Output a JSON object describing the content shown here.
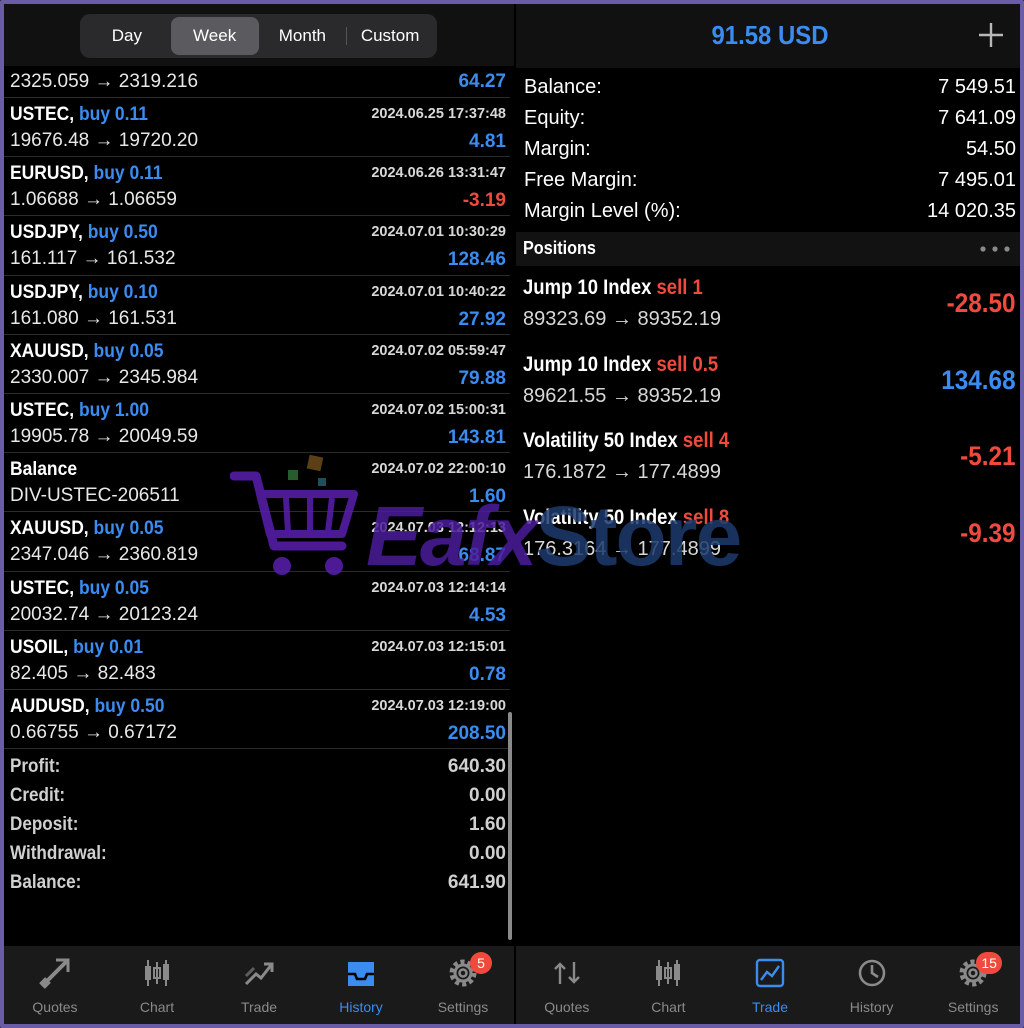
{
  "left": {
    "segments": [
      {
        "label": "Day",
        "active": false
      },
      {
        "label": "Week",
        "active": true
      },
      {
        "label": "Month",
        "active": false
      },
      {
        "label": "Custom",
        "active": false
      }
    ],
    "first_row": {
      "price": "2325.059 → 2319.216",
      "profit": "64.27"
    },
    "deals": [
      {
        "symbol": "USTEC,",
        "side": "buy 0.11",
        "date": "2024.06.25 17:37:48",
        "price": "19676.48 → 19720.20",
        "profit": "4.81",
        "negative": false
      },
      {
        "symbol": "EURUSD,",
        "side": "buy 0.11",
        "date": "2024.06.26 13:31:47",
        "price": "1.06688 → 1.06659",
        "profit": "-3.19",
        "negative": true
      },
      {
        "symbol": "USDJPY,",
        "side": "buy 0.50",
        "date": "2024.07.01 10:30:29",
        "price": "161.117 → 161.532",
        "profit": "128.46",
        "negative": false
      },
      {
        "symbol": "USDJPY,",
        "side": "buy 0.10",
        "date": "2024.07.01 10:40:22",
        "price": "161.080 → 161.531",
        "profit": "27.92",
        "negative": false
      },
      {
        "symbol": "XAUUSD,",
        "side": "buy 0.05",
        "date": "2024.07.02 05:59:47",
        "price": "2330.007 → 2345.984",
        "profit": "79.88",
        "negative": false
      },
      {
        "symbol": "USTEC,",
        "side": "buy 1.00",
        "date": "2024.07.02 15:00:31",
        "price": "19905.78 → 20049.59",
        "profit": "143.81",
        "negative": false
      },
      {
        "symbol": "Balance",
        "side": "",
        "date": "2024.07.02 22:00:10",
        "price": "DIV-USTEC-206511",
        "profit": "1.60",
        "negative": false
      },
      {
        "symbol": "XAUUSD,",
        "side": "buy 0.05",
        "date": "2024.07.03 12:12:13",
        "price": "2347.046 → 2360.819",
        "profit": "68.87",
        "negative": false
      },
      {
        "symbol": "USTEC,",
        "side": "buy 0.05",
        "date": "2024.07.03 12:14:14",
        "price": "20032.74 → 20123.24",
        "profit": "4.53",
        "negative": false
      },
      {
        "symbol": "USOIL,",
        "side": "buy 0.01",
        "date": "2024.07.03 12:15:01",
        "price": "82.405 → 82.483",
        "profit": "0.78",
        "negative": false
      },
      {
        "symbol": "AUDUSD,",
        "side": "buy 0.50",
        "date": "2024.07.03 12:19:00",
        "price": "0.66755 → 0.67172",
        "profit": "208.50",
        "negative": false
      }
    ],
    "summary": [
      {
        "label": "Profit:",
        "value": "640.30"
      },
      {
        "label": "Credit:",
        "value": "0.00"
      },
      {
        "label": "Deposit:",
        "value": "1.60"
      },
      {
        "label": "Withdrawal:",
        "value": "0.00"
      },
      {
        "label": "Balance:",
        "value": "641.90"
      }
    ],
    "tabs": [
      {
        "label": "Quotes",
        "icon": "quotes-icon",
        "active": false
      },
      {
        "label": "Chart",
        "icon": "chart-icon",
        "active": false
      },
      {
        "label": "Trade",
        "icon": "trade-icon",
        "active": false
      },
      {
        "label": "History",
        "icon": "history-icon",
        "active": true
      },
      {
        "label": "Settings",
        "icon": "gear-icon",
        "active": false,
        "badge": "5"
      }
    ]
  },
  "right": {
    "title": "91.58 USD",
    "account": [
      {
        "label": "Balance:",
        "value": "7 549.51"
      },
      {
        "label": "Equity:",
        "value": "7 641.09"
      },
      {
        "label": "Margin:",
        "value": "54.50"
      },
      {
        "label": "Free Margin:",
        "value": "7 495.01"
      },
      {
        "label": "Margin Level (%):",
        "value": "14 020.35"
      }
    ],
    "positions_label": "Positions",
    "positions": [
      {
        "symbol": "Jump 10 Index",
        "side": "sell 1",
        "price": "89323.69 → 89352.19",
        "profit": "-28.50",
        "negative": true
      },
      {
        "symbol": "Jump 10 Index",
        "side": "sell 0.5",
        "price": "89621.55 → 89352.19",
        "profit": "134.68",
        "negative": false
      },
      {
        "symbol": "Volatility 50 Index",
        "side": "sell 4",
        "price": "176.1872 → 177.4899",
        "profit": "-5.21",
        "negative": true
      },
      {
        "symbol": "Volatility 50 Index",
        "side": "sell 8",
        "price": "176.3164 → 177.4899",
        "profit": "-9.39",
        "negative": true
      }
    ],
    "tabs": [
      {
        "label": "Quotes",
        "icon": "quotes-icon",
        "active": false
      },
      {
        "label": "Chart",
        "icon": "chart-icon",
        "active": false
      },
      {
        "label": "Trade",
        "icon": "trade-icon",
        "active": true
      },
      {
        "label": "History",
        "icon": "history-icon",
        "active": false
      },
      {
        "label": "Settings",
        "icon": "gear-icon",
        "active": false,
        "badge": "15"
      }
    ]
  },
  "watermark": {
    "text_a": "Eafx",
    "text_b": "Store"
  },
  "colors": {
    "accent": "#3b8cf0",
    "negative": "#f04a3e",
    "frame": "#6b5ca8"
  }
}
